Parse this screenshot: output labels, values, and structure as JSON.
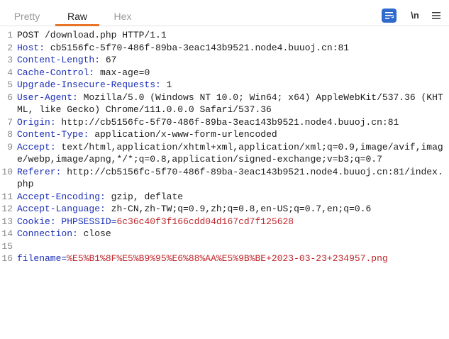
{
  "tabs": [
    {
      "label": "Pretty",
      "active": false
    },
    {
      "label": "Raw",
      "active": true
    },
    {
      "label": "Hex",
      "active": false
    }
  ],
  "toolbar": {
    "wrap_icon": "wrap-text-icon",
    "newline_label": "\\n",
    "menu_icon": "hamburger-menu-icon",
    "accent_color": "#e8742a",
    "wrap_bg_color": "#2f6bcd"
  },
  "request": {
    "lines": [
      {
        "num": "1",
        "text": "POST /download.php HTTP/1.1"
      },
      {
        "num": "2",
        "name": "Host",
        "value": " cb5156fc-5f70-486f-89ba-3eac143b9521.node4.buuoj.cn:81"
      },
      {
        "num": "3",
        "name": "Content-Length",
        "value": " 67"
      },
      {
        "num": "4",
        "name": "Cache-Control",
        "value": " max-age=0"
      },
      {
        "num": "5",
        "name": "Upgrade-Insecure-Requests",
        "value": " 1"
      },
      {
        "num": "6",
        "name": "User-Agent",
        "value": " Mozilla/5.0 (Windows NT 10.0; Win64; x64) AppleWebKit/537.36 (KHTML, like Gecko) Chrome/111.0.0.0 Safari/537.36"
      },
      {
        "num": "7",
        "name": "Origin",
        "value": " http://cb5156fc-5f70-486f-89ba-3eac143b9521.node4.buuoj.cn:81"
      },
      {
        "num": "8",
        "name": "Content-Type",
        "value": " application/x-www-form-urlencoded"
      },
      {
        "num": "9",
        "name": "Accept",
        "value": " text/html,application/xhtml+xml,application/xml;q=0.9,image/avif,image/webp,image/apng,*/*;q=0.8,application/signed-exchange;v=b3;q=0.7"
      },
      {
        "num": "10",
        "name": "Referer",
        "value": " http://cb5156fc-5f70-486f-89ba-3eac143b9521.node4.buuoj.cn:81/index.php"
      },
      {
        "num": "11",
        "name": "Accept-Encoding",
        "value": " gzip, deflate"
      },
      {
        "num": "12",
        "name": "Accept-Language",
        "value": " zh-CN,zh-TW;q=0.9,zh;q=0.8,en-US;q=0.7,en;q=0.6"
      },
      {
        "num": "13",
        "name": "Cookie",
        "cookie_name": "PHPSESSID",
        "cookie_value": "6c36c40f3f166cdd04d167cd7f125628"
      },
      {
        "num": "14",
        "name": "Connection",
        "value": " close"
      },
      {
        "num": "15",
        "text": ""
      },
      {
        "num": "16",
        "param_name": "filename",
        "param_value": "%E5%B1%8F%E5%B9%95%E6%88%AA%E5%9B%BE+2023-03-23+234957.png"
      }
    ]
  }
}
